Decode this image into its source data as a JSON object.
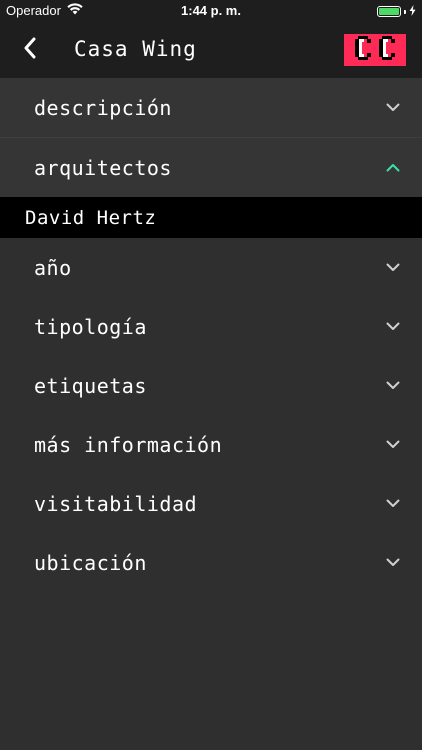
{
  "status_bar": {
    "carrier": "Operador",
    "time": "1:44 p. m.",
    "battery_level_percent": 100,
    "battery_color": "#4cd964"
  },
  "nav": {
    "title": "Casa Wing",
    "back_icon": "chevron-left-icon",
    "logo_color": "#ff2a55"
  },
  "colors": {
    "background": "#2f2f2f",
    "bar": "#1e1e1e",
    "accent_chevron_up": "#3ddfa8",
    "chevron_down": "#d0d0d0",
    "expanded_bg": "#000000"
  },
  "sections": [
    {
      "label": "descripción",
      "expanded": false
    },
    {
      "label": "arquitectos",
      "expanded": true,
      "content": "David Hertz"
    },
    {
      "label": "año",
      "expanded": false
    },
    {
      "label": "tipología",
      "expanded": false
    },
    {
      "label": "etiquetas",
      "expanded": false
    },
    {
      "label": "más información",
      "expanded": false
    },
    {
      "label": "visitabilidad",
      "expanded": false
    },
    {
      "label": "ubicación",
      "expanded": false
    }
  ]
}
